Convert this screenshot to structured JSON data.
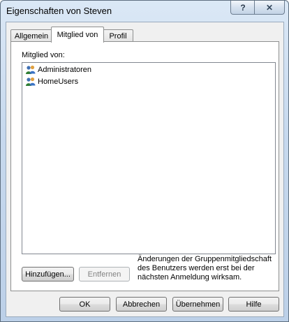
{
  "window": {
    "title": "Eigenschaften von Steven",
    "help_glyph": "?",
    "close_glyph": "✕"
  },
  "tabs": [
    {
      "label": "Allgemein",
      "active": false
    },
    {
      "label": "Mitglied von",
      "active": true
    },
    {
      "label": "Profil",
      "active": false
    }
  ],
  "member_of": {
    "label": "Mitglied von:",
    "items": [
      {
        "label": "Administratoren",
        "icon": "group-icon"
      },
      {
        "label": "HomeUsers",
        "icon": "group-icon"
      }
    ]
  },
  "actions": {
    "add_label": "Hinzufügen...",
    "remove_label": "Entfernen",
    "note_lines": [
      "Änderungen der Gruppenmitgliedschaft",
      "des Benutzers werden erst bei der",
      "nächsten Anmeldung wirksam."
    ]
  },
  "footer": {
    "ok_label": "OK",
    "cancel_label": "Abbrechen",
    "apply_label": "Übernehmen",
    "help_label": "Hilfe"
  },
  "colors": {
    "title_bar": "#c7d9ee",
    "dialog_bg": "#f0f0f0",
    "disabled_text": "#838383"
  }
}
